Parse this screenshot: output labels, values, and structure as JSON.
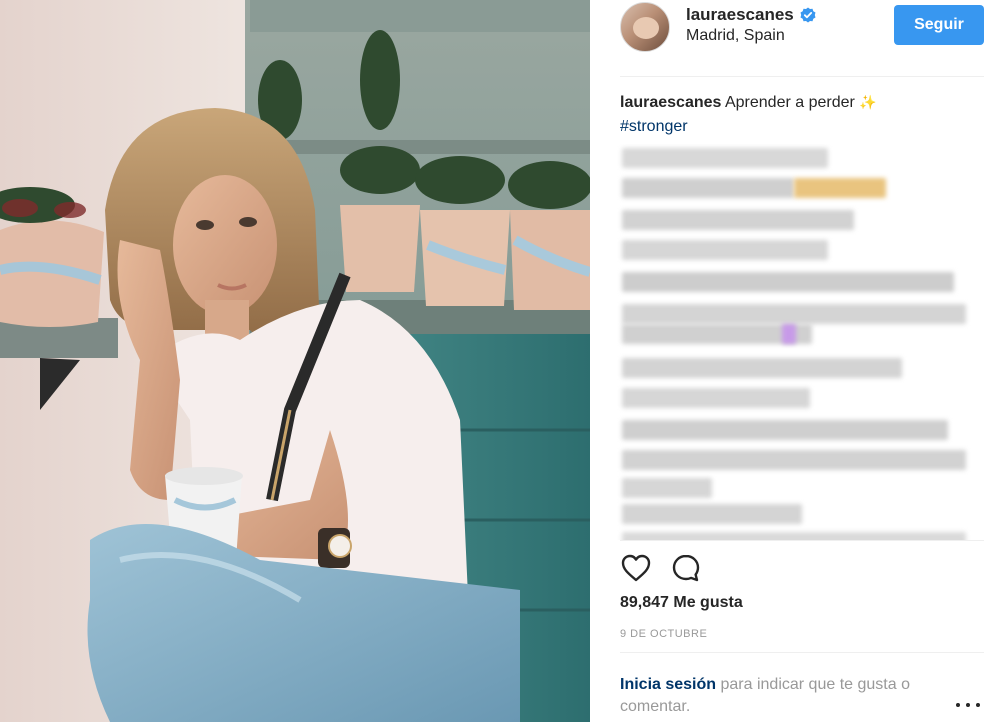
{
  "post": {
    "username": "lauraescanes",
    "location": "Madrid, Spain",
    "follow_label": "Seguir",
    "verified_icon": "verified-badge-icon"
  },
  "caption": {
    "username": "lauraescanes",
    "text": "Aprender a perder",
    "emoji_icon": "sparkle-icon",
    "hashtag": "#stronger"
  },
  "engagement": {
    "likes": "89,847 Me gusta",
    "date": "9 de octubre",
    "like_icon": "heart-icon",
    "comment_icon": "comment-icon"
  },
  "footer": {
    "login_link": "Inicia sesión",
    "login_rest": "para indicar que te gusta o comentar.",
    "more_icon": "more-options-icon"
  },
  "colors": {
    "accent": "#3897f0",
    "link": "#003569",
    "muted": "#999999",
    "text": "#262626"
  }
}
